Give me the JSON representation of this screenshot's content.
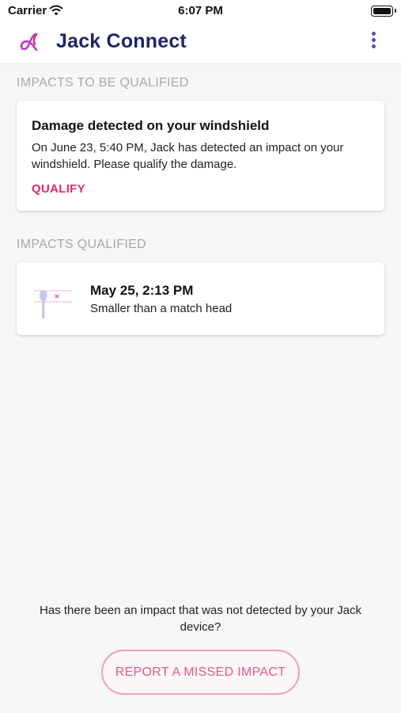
{
  "status_bar": {
    "carrier": "Carrier",
    "time": "6:07 PM"
  },
  "header": {
    "title": "Jack Connect",
    "logo_icon": "jack-connect-logo",
    "menu_icon": "more-vertical-icon"
  },
  "sections": {
    "to_be_qualified": {
      "title": "IMPACTS TO BE QUALIFIED",
      "card": {
        "title": "Damage detected on your windshield",
        "text": "On June 23, 5:40 PM, Jack has detected an impact on your windshield. Please qualify the damage.",
        "action": "QUALIFY"
      }
    },
    "qualified": {
      "title": "IMPACTS QUALIFIED",
      "items": [
        {
          "date": "May 25, 2:13 PM",
          "description": "Smaller than a match head",
          "icon": "match-head-icon"
        }
      ]
    }
  },
  "footer": {
    "question": "Has there been an impact that was not detected by your Jack device?",
    "report_button": "REPORT A MISSED IMPACT"
  },
  "colors": {
    "accent": "#e62968",
    "brand": "#1f2566",
    "menu": "#4b54c4"
  }
}
